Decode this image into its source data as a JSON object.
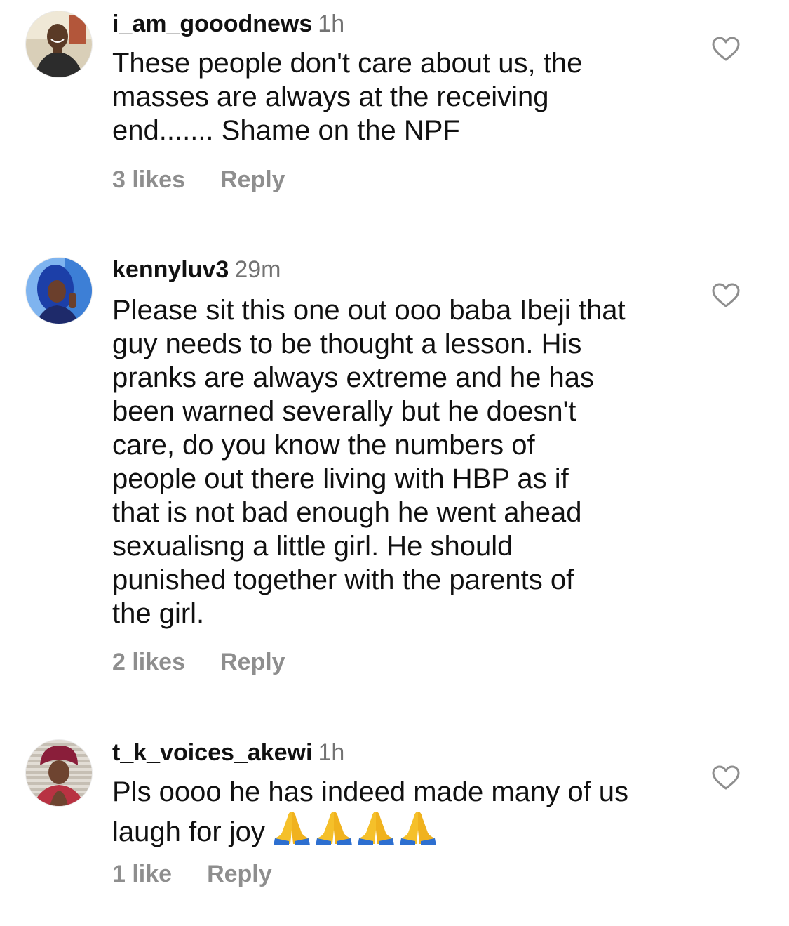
{
  "comments": [
    {
      "username": "i_am_gooodnews",
      "time": "1h",
      "lines": [
        "These people don't care about us, the",
        "masses are always at the receiving",
        "end....... Shame on the NPF"
      ],
      "likes": "3 likes",
      "reply": "Reply",
      "avatar_icon": "avatar-man-smiling",
      "like_icon": "heart-outline-icon"
    },
    {
      "username": "kennyluv3",
      "time": "29m",
      "lines": [
        "Please sit this one out ooo baba Ibeji that",
        "guy needs to be thought a lesson. His",
        "pranks are always extreme and he has",
        "been warned severally but he doesn't",
        "care, do you know the numbers of",
        "people out there living with HBP as if",
        "that is not bad enough he went ahead",
        "sexualisng a little girl. He should",
        "punished together with the parents of",
        "the girl."
      ],
      "likes": "2 likes",
      "reply": "Reply",
      "avatar_icon": "avatar-woman-blue-hair",
      "like_icon": "heart-outline-icon"
    },
    {
      "username": "t_k_voices_akewi",
      "time": "1h",
      "lines": [
        "Pls oooo he has indeed made many of us",
        "laugh for joy"
      ],
      "emojis": [
        "🙏",
        "🙏",
        "🙏",
        "🙏"
      ],
      "likes": "1 like",
      "reply": "Reply",
      "avatar_icon": "avatar-woman-headwrap",
      "like_icon": "heart-outline-icon"
    }
  ],
  "colors": {
    "text_primary": "#111111",
    "text_secondary": "#737373",
    "meta_text": "#8e8e8e",
    "background": "#ffffff"
  }
}
